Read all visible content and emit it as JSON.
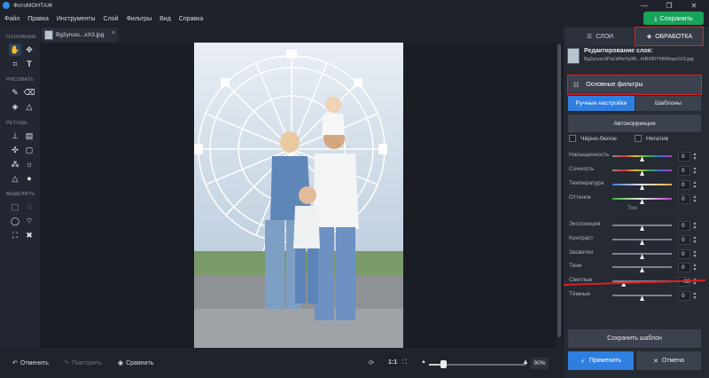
{
  "titlebar": {
    "title": "ФотоМОНТАЖ",
    "minimize": "—",
    "maximize": "❐",
    "close": "✕"
  },
  "menu": [
    "Файл",
    "Правка",
    "Инструменты",
    "Слой",
    "Фильтры",
    "Вид",
    "Справка"
  ],
  "save_button": {
    "label": "Сохранить",
    "icon": "download-icon"
  },
  "left_tools": {
    "sections": [
      "ОСНОВНЫЕ",
      "РИСОВАТЬ",
      "РЕТУШЬ",
      "ВЫДЕЛИТЬ"
    ]
  },
  "file_tab": {
    "name": "Bg2yrusc...xX3.jpg",
    "close": "×"
  },
  "bottom": {
    "undo": "Отменить",
    "redo": "Повторить",
    "compare": "Сравнить",
    "ratio": "1:1",
    "zoom": "90%",
    "zoom_level": 0.15
  },
  "right_panel": {
    "tabs": [
      {
        "label": "СЛОИ"
      },
      {
        "label": "ОБРАБОТКА"
      }
    ],
    "edit_layer_title": "Редактирование слоя:",
    "edit_layer_file": "Bg2yrusc0PaLWfwYp3R...fdBXBIYhBNhqxXX3.jpg",
    "basic_filters": "Основные фильтры",
    "modes": [
      "Ручные настройки",
      "Шаблоны"
    ],
    "autocorrection": "Автокоррекция",
    "bw": "Чёрно-белое",
    "negative": "Негатив",
    "ton_heading": "Тон",
    "sliders": [
      {
        "label": "Насыщенность",
        "value": "0",
        "pos": 0.5
      },
      {
        "label": "Сочность",
        "value": "0",
        "pos": 0.5
      },
      {
        "label": "Температура",
        "value": "0",
        "pos": 0.5
      },
      {
        "label": "Оттенок",
        "value": "0",
        "pos": 0.5
      },
      {
        "label": "Экспозиция",
        "value": "0",
        "pos": 0.5
      },
      {
        "label": "Контраст",
        "value": "0",
        "pos": 0.5
      },
      {
        "label": "Засветки",
        "value": "0",
        "pos": 0.5
      },
      {
        "label": "Тени",
        "value": "0",
        "pos": 0.5
      },
      {
        "label": "Светлые",
        "value": "-62",
        "pos": 0.19
      },
      {
        "label": "Тёмные",
        "value": "0",
        "pos": 0.5
      }
    ],
    "save_template": "Сохранить шаблон",
    "apply": "Применить",
    "cancel": "Отмена"
  },
  "colors": {
    "accent": "#2f7fe0",
    "save_green": "#17a35a",
    "highlight_red": "#e02020"
  }
}
